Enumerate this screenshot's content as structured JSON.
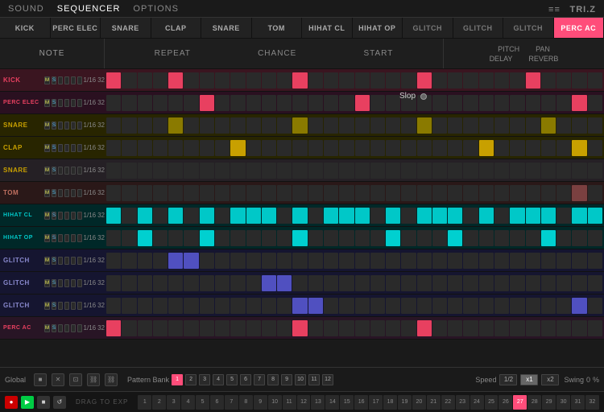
{
  "nav": {
    "sound": "SOUND",
    "sequencer": "SEQUENCER",
    "options": "OPTIONS",
    "logo": "TRI.Z",
    "logo_lines": "≡≡"
  },
  "track_tabs": [
    {
      "label": "KICK",
      "active": false
    },
    {
      "label": "PERC ELEC",
      "active": false
    },
    {
      "label": "SNARE",
      "active": false
    },
    {
      "label": "CLAP",
      "active": false
    },
    {
      "label": "SNARE",
      "active": false
    },
    {
      "label": "TOM",
      "active": false
    },
    {
      "label": "HIHAT CL",
      "active": false
    },
    {
      "label": "HIHAT OP",
      "active": false
    },
    {
      "label": "GLITCH",
      "active": false
    },
    {
      "label": "GLITCH",
      "active": false
    },
    {
      "label": "GLITCH",
      "active": false
    },
    {
      "label": "PERC AC",
      "active": true
    }
  ],
  "sub_header": {
    "note": "NOTE",
    "repeat": "REPEAT",
    "chance": "CHANCE",
    "start": "START",
    "pitch": "PITCH",
    "pan": "PAN",
    "delay": "DELAY",
    "reverb": "REVERB",
    "slop": "Slop"
  },
  "tracks": [
    {
      "label": "KICK",
      "color": "kick",
      "m": "M",
      "s": "S",
      "rate": "1/16",
      "steps": "32"
    },
    {
      "label": "PERC ELEC",
      "color": "perc",
      "m": "M",
      "s": "S",
      "rate": "1/16",
      "steps": "32"
    },
    {
      "label": "SNARE",
      "color": "snare",
      "m": "M",
      "s": "S",
      "rate": "1/16",
      "steps": "32"
    },
    {
      "label": "CLAP",
      "color": "clap",
      "m": "M",
      "s": "S",
      "rate": "1/16",
      "steps": "32"
    },
    {
      "label": "SNARE",
      "color": "snare2",
      "m": "M",
      "s": "S",
      "rate": "1/16",
      "steps": "32"
    },
    {
      "label": "TOM",
      "color": "tom",
      "m": "M",
      "s": "S",
      "rate": "1/16",
      "steps": "32"
    },
    {
      "label": "HIHAT CL",
      "color": "hihatcl",
      "m": "M",
      "s": "S",
      "rate": "1/16",
      "steps": "32"
    },
    {
      "label": "HIHAT OP",
      "color": "hihatop",
      "m": "M",
      "s": "S",
      "rate": "1/16",
      "steps": "32"
    },
    {
      "label": "GLITCH",
      "color": "glitch1",
      "m": "M",
      "s": "S",
      "rate": "1/16",
      "steps": "32"
    },
    {
      "label": "GLITCH",
      "color": "glitch2",
      "m": "M",
      "s": "S",
      "rate": "1/16",
      "steps": "32"
    },
    {
      "label": "GLITCH",
      "color": "glitch3",
      "m": "M",
      "s": "S",
      "rate": "1/16",
      "steps": "32"
    },
    {
      "label": "PERC AC",
      "color": "percac",
      "m": "M",
      "s": "S",
      "rate": "1/16",
      "steps": "32"
    }
  ],
  "bottom": {
    "global": "Global",
    "pattern_bank_label": "Pattern Bank",
    "speed_label": "Speed",
    "speed_half": "1/2",
    "speed_1": "x1",
    "speed_2": "x2",
    "swing_label": "Swing",
    "swing_val": "0",
    "swing_pct": "%"
  },
  "transport": {
    "drag_label": "DRAG TO EXP"
  },
  "pattern_buttons": [
    "1",
    "2",
    "3",
    "4",
    "5",
    "6",
    "7",
    "8",
    "9",
    "10",
    "11",
    "12"
  ],
  "bar_numbers": [
    "1",
    "2",
    "3",
    "4",
    "5",
    "6",
    "7",
    "8",
    "9",
    "10",
    "11",
    "12",
    "13",
    "14",
    "15",
    "16",
    "17",
    "18",
    "19",
    "20",
    "21",
    "22",
    "23",
    "24",
    "25",
    "26",
    "27",
    "28",
    "29",
    "30",
    "31",
    "32"
  ]
}
